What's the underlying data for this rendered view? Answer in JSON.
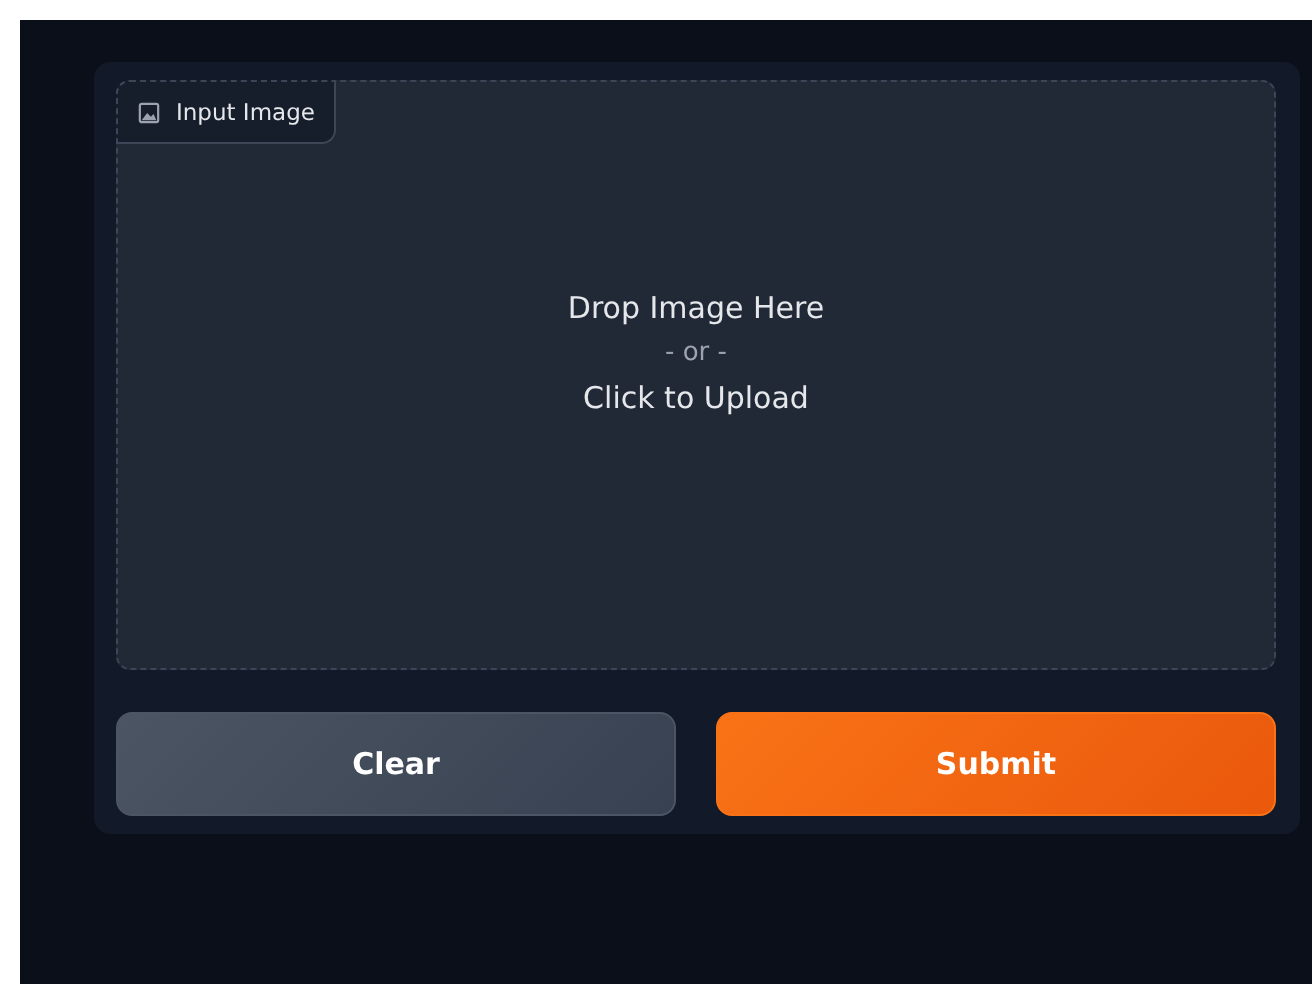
{
  "input": {
    "label": "Input Image",
    "drop_text": "Drop Image Here",
    "or_text": "- or -",
    "click_text": "Click to Upload"
  },
  "buttons": [
    {
      "label": "Clear",
      "kind": "secondary"
    },
    {
      "label": "Submit",
      "kind": "primary"
    }
  ]
}
